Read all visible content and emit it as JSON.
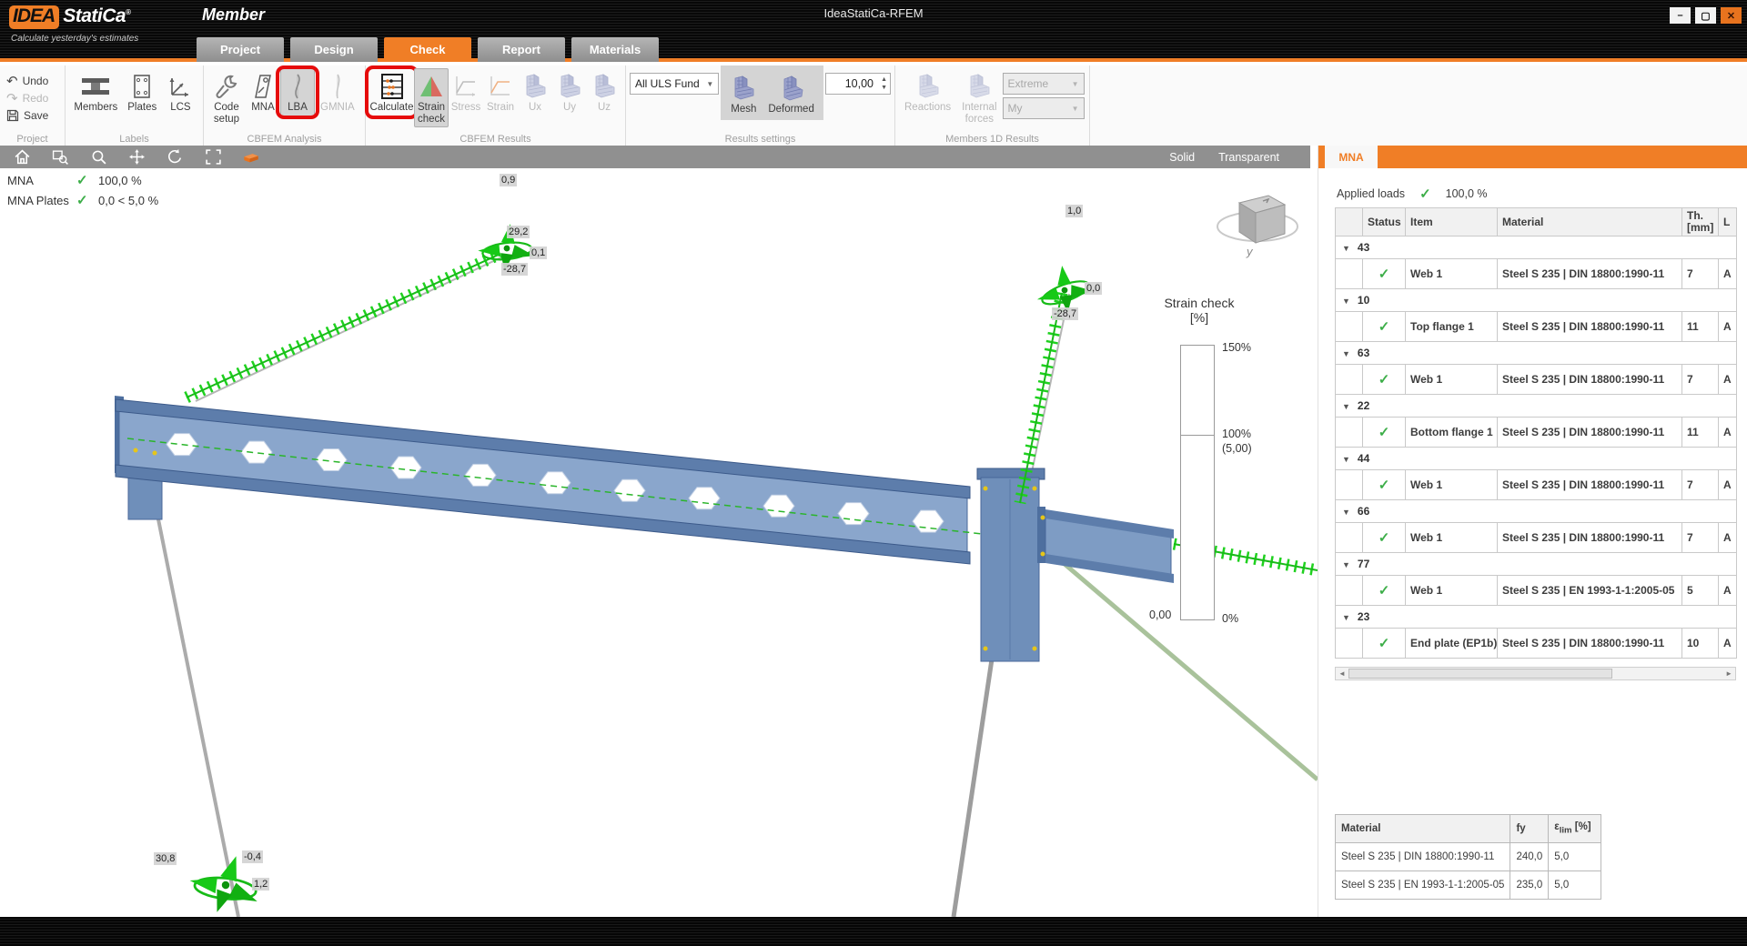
{
  "window": {
    "logo_primary": "IDEA",
    "logo_secondary": "StatiCa",
    "logo_reg": "®",
    "app_name": "Member",
    "tagline": "Calculate yesterday's estimates",
    "title": "IdeaStatiCa-RFEM",
    "controls": {
      "minimize": "–",
      "maximize": "▢",
      "close": "✕"
    }
  },
  "icons": {
    "undo": "↶",
    "redo": "↷",
    "collapse": "▼",
    "dropdown": "▼",
    "spin_up": "▲",
    "spin_down": "▼",
    "scroll_left": "◄",
    "scroll_right": "►"
  },
  "tabs": [
    {
      "label": "Project"
    },
    {
      "label": "Design"
    },
    {
      "label": "Check"
    },
    {
      "label": "Report"
    },
    {
      "label": "Materials"
    }
  ],
  "ribbon": {
    "groups": {
      "project": {
        "label": "Project",
        "undo": "Undo",
        "redo": "Redo",
        "save": "Save"
      },
      "labels": {
        "label": "Labels",
        "members": "Members",
        "plates": "Plates",
        "lcs": "LCS"
      },
      "cbfem_analysis": {
        "label": "CBFEM Analysis",
        "code_setup": "Code\nsetup",
        "mna": "MNA",
        "lba": "LBA",
        "gmnia": "GMNIA"
      },
      "cbfem_results": {
        "label": "CBFEM Results",
        "calculate": "Calculate",
        "strain_check": "Strain\ncheck",
        "stress": "Stress",
        "strain": "Strain",
        "ux": "Ux",
        "uy": "Uy",
        "uz": "Uz"
      },
      "results_settings": {
        "label": "Results settings",
        "load_combo": "All ULS Fund",
        "mesh": "Mesh",
        "deformed": "Deformed",
        "scale_value": "10,00"
      },
      "members_1d": {
        "label": "Members 1D Results",
        "reactions": "Reactions",
        "internal_forces": "Internal\nforces",
        "extreme": "Extreme",
        "my": "My"
      }
    }
  },
  "viewport": {
    "view_modes": {
      "solid": "Solid",
      "transparent": "Transparent"
    },
    "status": [
      {
        "name": "MNA",
        "check": "✓",
        "value": "100,0 %"
      },
      {
        "name": "MNA Plates",
        "check": "✓",
        "value": "0,0 < 5,0 %"
      }
    ],
    "value_labels": [
      "0,9",
      "29,2",
      "0,1",
      "-28,7",
      "1,0",
      "0,0",
      "-28,7",
      "30,8",
      "-0,4",
      "1,2"
    ],
    "legend": {
      "title": "Strain check",
      "unit": "[%]",
      "tick_top": "150%",
      "tick_mid": "100%",
      "tick_mid_note": "(5,00)",
      "tick_zero_left": "0,00",
      "tick_zero_right": "0%"
    },
    "nav_cube_axis": "y"
  },
  "panel": {
    "tab": "MNA",
    "applied_loads_label": "Applied loads",
    "applied_loads_value": "100,0 %",
    "check_mark": "✓",
    "results_table": {
      "headers": {
        "status": "Status",
        "item": "Item",
        "material": "Material",
        "th_line1": "Th.",
        "th_line2": "[mm]",
        "last": "L"
      },
      "groups": [
        {
          "id": "43",
          "item": "Web 1",
          "material": "Steel S 235 | DIN 18800:1990-11",
          "th": "7",
          "last": "A"
        },
        {
          "id": "10",
          "item": "Top flange 1",
          "material": "Steel S 235 | DIN 18800:1990-11",
          "th": "11",
          "last": "A"
        },
        {
          "id": "63",
          "item": "Web 1",
          "material": "Steel S 235 | DIN 18800:1990-11",
          "th": "7",
          "last": "A"
        },
        {
          "id": "22",
          "item": "Bottom flange 1",
          "material": "Steel S 235 | DIN 18800:1990-11",
          "th": "11",
          "last": "A"
        },
        {
          "id": "44",
          "item": "Web 1",
          "material": "Steel S 235 | DIN 18800:1990-11",
          "th": "7",
          "last": "A"
        },
        {
          "id": "66",
          "item": "Web 1",
          "material": "Steel S 235 | DIN 18800:1990-11",
          "th": "7",
          "last": "A"
        },
        {
          "id": "77",
          "item": "Web 1",
          "material": "Steel S 235 | EN 1993-1-1:2005-05",
          "th": "5",
          "last": "A"
        },
        {
          "id": "23",
          "item": "End plate (EP1b)",
          "material": "Steel S 235 | DIN 18800:1990-11",
          "th": "10",
          "last": "A"
        }
      ]
    },
    "materials_table": {
      "headers": {
        "material": "Material",
        "fy": "fy",
        "eps": "ε",
        "eps_sub": "lim",
        "eps_unit": "[%]"
      },
      "rows": [
        {
          "material": "Steel S 235 | DIN 18800:1990-11",
          "fy": "240,0",
          "eps": "5,0"
        },
        {
          "material": "Steel S 235 | EN 1993-1-1:2005-05",
          "fy": "235,0",
          "eps": "5,0"
        }
      ]
    }
  },
  "colors": {
    "accent_orange": "#F07E26",
    "status_green": "#3DAE49",
    "steel_blue": "#7E9CC4",
    "load_green": "#1FCC1F"
  }
}
